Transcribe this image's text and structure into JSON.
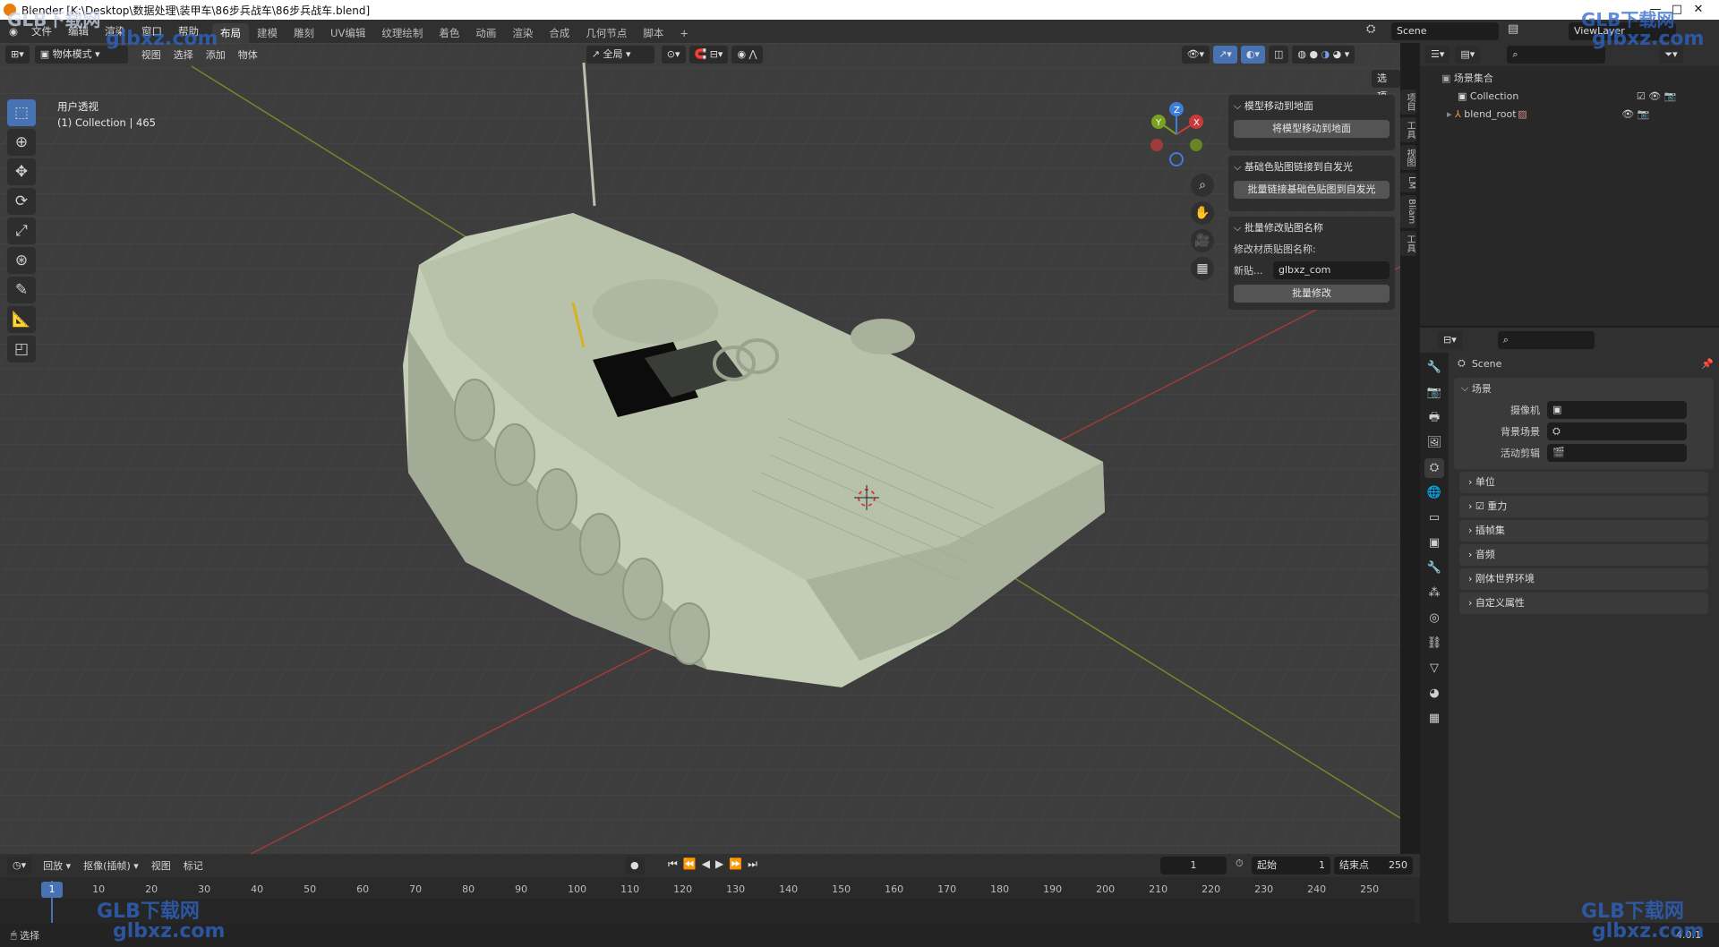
{
  "window": {
    "title": "Blender [K:\\Desktop\\数据处理\\装甲车\\86步兵战车\\86步兵战车.blend]",
    "minimize": "—",
    "maximize": "□",
    "close": "✕"
  },
  "topbar": {
    "menus": [
      "文件",
      "编辑",
      "渲染",
      "窗口",
      "帮助"
    ],
    "workspaces": [
      "布局",
      "建模",
      "雕刻",
      "UV编辑",
      "纹理绘制",
      "着色",
      "动画",
      "渲染",
      "合成",
      "几何节点",
      "脚本"
    ],
    "active_workspace": "布局",
    "add_tab": "+",
    "scene": "Scene",
    "view_layer": "ViewLayer"
  },
  "viewport": {
    "mode": "物体模式",
    "menus": [
      "视图",
      "选择",
      "添加",
      "物体"
    ],
    "transform_orientation": "全局",
    "options": "选项",
    "overlay_title": "用户透视",
    "overlay_info": "(1) Collection | 465",
    "gizmo": {
      "x": "X",
      "y": "Y",
      "z": "Z"
    }
  },
  "npanel": {
    "sections": [
      {
        "title": "模型移动到地面",
        "button": "将模型移动到地面"
      },
      {
        "title": "基础色贴图链接到自发光",
        "button": "批量链接基础色贴图到自发光"
      },
      {
        "title": "批量修改贴图名称",
        "label": "修改材质贴图名称:",
        "field_label": "新贴...",
        "field_value": "glbxz_com",
        "button": "批量修改"
      }
    ],
    "tabs": [
      "项目",
      "工具",
      "视图",
      "LM",
      "Bliam",
      "工具"
    ]
  },
  "outliner": {
    "root": "场景集合",
    "items": [
      {
        "label": "Collection"
      },
      {
        "label": "blend_root"
      }
    ]
  },
  "properties": {
    "scene_name": "Scene",
    "panel_title": "场景",
    "fields": [
      {
        "label": "摄像机",
        "value": ""
      },
      {
        "label": "背景场景",
        "value": ""
      },
      {
        "label": "活动剪辑",
        "value": ""
      }
    ],
    "sections": [
      "单位",
      "重力",
      "插帧集",
      "音频",
      "刚体世界环境",
      "自定义属性"
    ]
  },
  "timeline": {
    "menus": [
      "回放",
      "抠像(插帧)",
      "视图",
      "标记"
    ],
    "current_frame": "1",
    "start_label": "起始",
    "start": "1",
    "end_label": "结束点",
    "end": "250",
    "ticks": [
      "1",
      "10",
      "20",
      "30",
      "40",
      "50",
      "60",
      "70",
      "80",
      "90",
      "100",
      "110",
      "120",
      "130",
      "140",
      "150",
      "160",
      "170",
      "180",
      "190",
      "200",
      "210",
      "220",
      "230",
      "240",
      "250"
    ]
  },
  "statusbar": {
    "left": "选择",
    "version": "4.0.1"
  },
  "watermark": {
    "brand": "GLB下载网",
    "url": "glbxz.com"
  },
  "colors": {
    "accent": "#4772b3",
    "axis_x": "#c83b3b",
    "axis_y": "#7aa21e",
    "axis_z": "#3d7ddb",
    "model": "#b9c4ad"
  }
}
